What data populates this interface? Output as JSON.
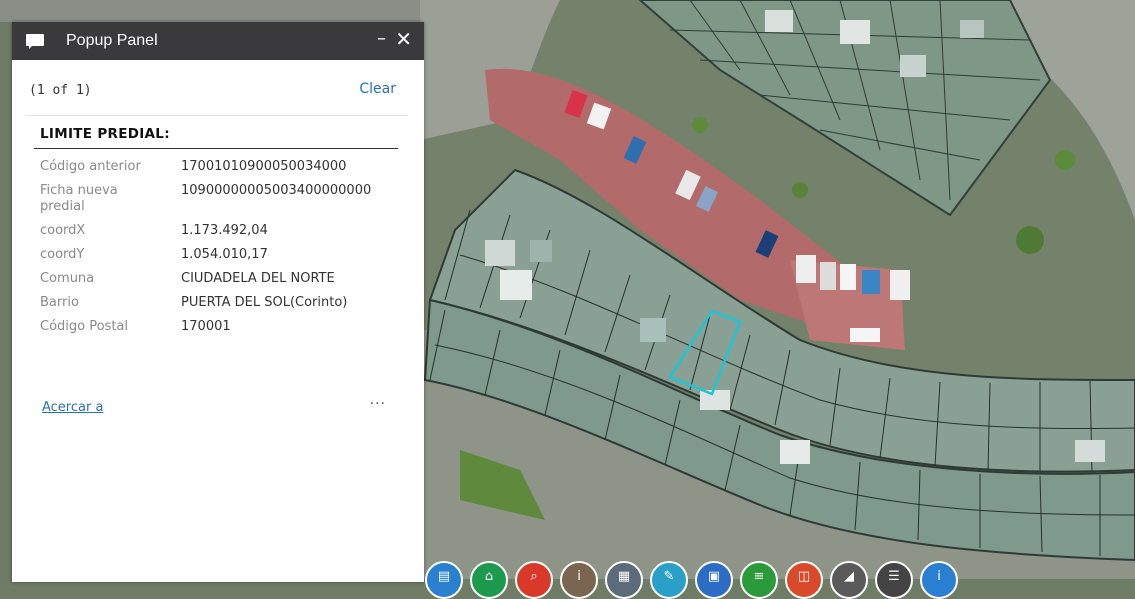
{
  "panel": {
    "title": "Popup Panel",
    "minimize_glyph": "–",
    "close_glyph": "✕",
    "counter": "(1 of 1)",
    "clear_label": "Clear",
    "section_title": "LIMITE PREDIAL:",
    "fields": [
      {
        "label": "Código anterior",
        "value": "17001010900050034000"
      },
      {
        "label": "Ficha nueva predial",
        "value": "10900000005003400000000"
      },
      {
        "label": "coordX",
        "value": "1.173.492,04"
      },
      {
        "label": "coordY",
        "value": "1.054.010,17"
      },
      {
        "label": "Comuna",
        "value": "CIUDADELA DEL NORTE"
      },
      {
        "label": "Barrio",
        "value": "PUERTA DEL SOL(Corinto)"
      },
      {
        "label": "Código Postal",
        "value": "170001"
      }
    ],
    "zoom_link": "Acercar a",
    "more_glyph": "···"
  },
  "toolbar": {
    "tools": [
      {
        "icon": "layers-icon",
        "color": "#2b7fd0",
        "glyph": "▤"
      },
      {
        "icon": "home-icon",
        "color": "#1e9a4f",
        "glyph": "⌂"
      },
      {
        "icon": "search-icon",
        "color": "#d9392b",
        "glyph": "⌕"
      },
      {
        "icon": "info-icon",
        "color": "#7a6550",
        "glyph": "i"
      },
      {
        "icon": "table-icon",
        "color": "#5b6b7a",
        "glyph": "▦"
      },
      {
        "icon": "draw-icon",
        "color": "#2aa0c8",
        "glyph": "✎"
      },
      {
        "icon": "print-icon",
        "color": "#2b6cc4",
        "glyph": "▣"
      },
      {
        "icon": "legend-icon",
        "color": "#2a9a3a",
        "glyph": "≡"
      },
      {
        "icon": "basemap-icon",
        "color": "#d94a2a",
        "glyph": "◫"
      },
      {
        "icon": "measure-icon",
        "color": "#5a5a5a",
        "glyph": "◢"
      },
      {
        "icon": "list-icon",
        "color": "#444444",
        "glyph": "☰"
      },
      {
        "icon": "about-icon",
        "color": "#2b7fd0",
        "glyph": "i"
      }
    ]
  },
  "colors": {
    "header_bg": "#3a3a3c",
    "link": "#2a6fb4",
    "parcel_highlight": "#1cc6d6"
  }
}
